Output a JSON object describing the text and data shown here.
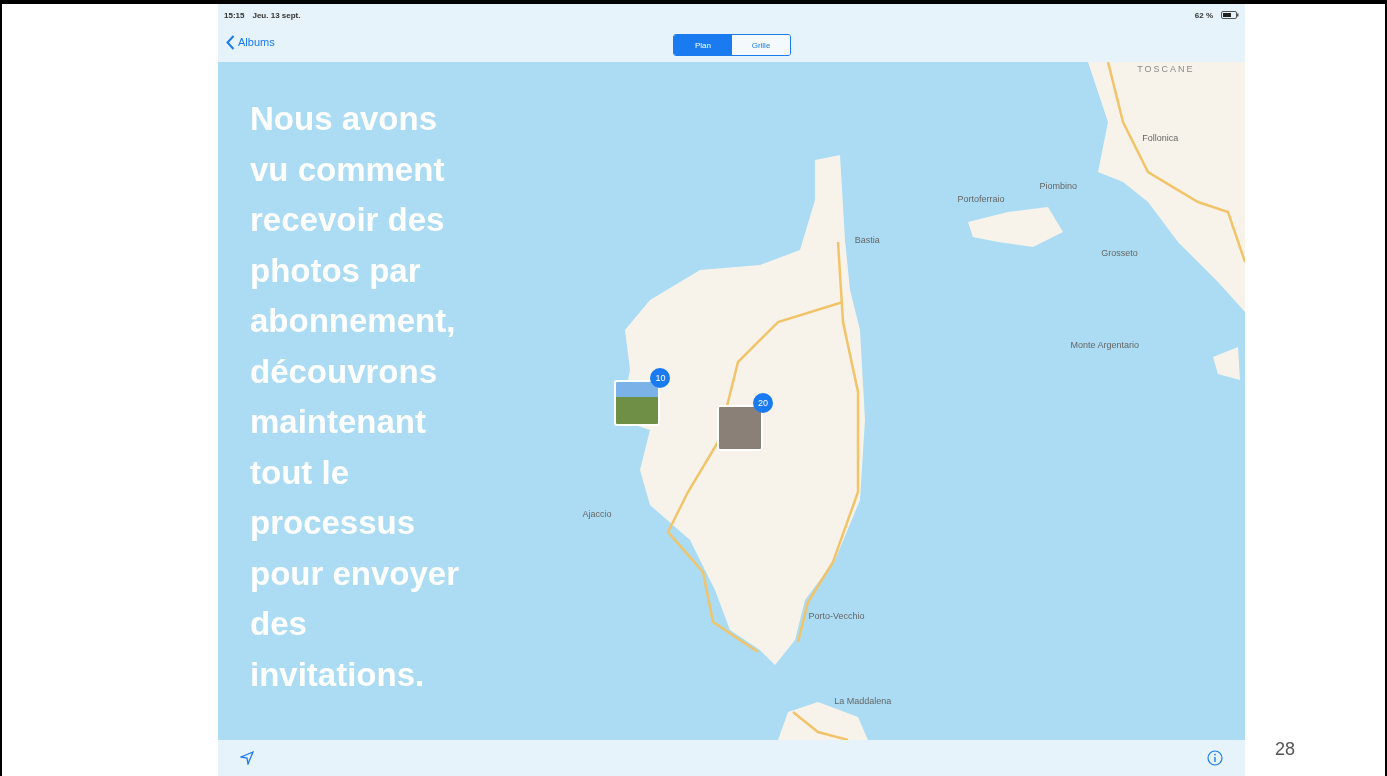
{
  "status_bar": {
    "time": "15:15",
    "date": "Jeu. 13 sept.",
    "battery": "62 %"
  },
  "nav_bar": {
    "back": "Albums",
    "segments": [
      {
        "label": "Plan",
        "selected": true
      },
      {
        "label": "Grille",
        "selected": false
      }
    ]
  },
  "slide_text": "Nous avons vu comment recevoir des photos par abonnement, découvrons maintenant tout le processus pour envoyer des invitations.",
  "map": {
    "labels": [
      {
        "text": "TOSCANE",
        "kind": "region"
      },
      {
        "text": "Bastia",
        "kind": "city"
      },
      {
        "text": "Ajaccio",
        "kind": "city"
      },
      {
        "text": "Porto-Vecchio",
        "kind": "city"
      },
      {
        "text": "La Maddalena",
        "kind": "city"
      },
      {
        "text": "Piombino",
        "kind": "city"
      },
      {
        "text": "Follonica",
        "kind": "city"
      },
      {
        "text": "Grosseto",
        "kind": "city"
      },
      {
        "text": "Portoferraio",
        "kind": "city"
      },
      {
        "text": "Monte Argentario",
        "kind": "city"
      }
    ],
    "photo_pins": [
      {
        "count": "10",
        "kind": "landscape"
      },
      {
        "count": "20",
        "kind": "stone"
      }
    ]
  },
  "slide_number": "28"
}
